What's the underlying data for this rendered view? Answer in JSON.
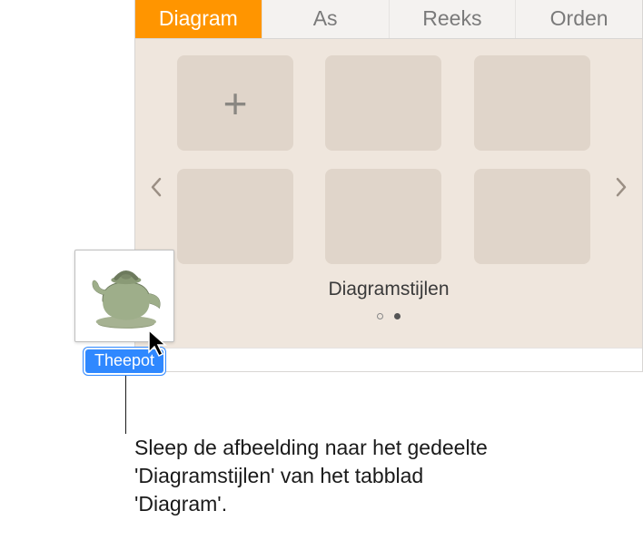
{
  "tabs": {
    "diagram": "Diagram",
    "as": "As",
    "reeks": "Reeks",
    "orden": "Orden"
  },
  "styles": {
    "label": "Diagramstijlen",
    "add_symbol": "+"
  },
  "drag": {
    "filename": "Theepot"
  },
  "callout": {
    "text": "Sleep de afbeelding naar het gedeelte 'Diagramstijlen' van het tabblad 'Diagram'."
  }
}
